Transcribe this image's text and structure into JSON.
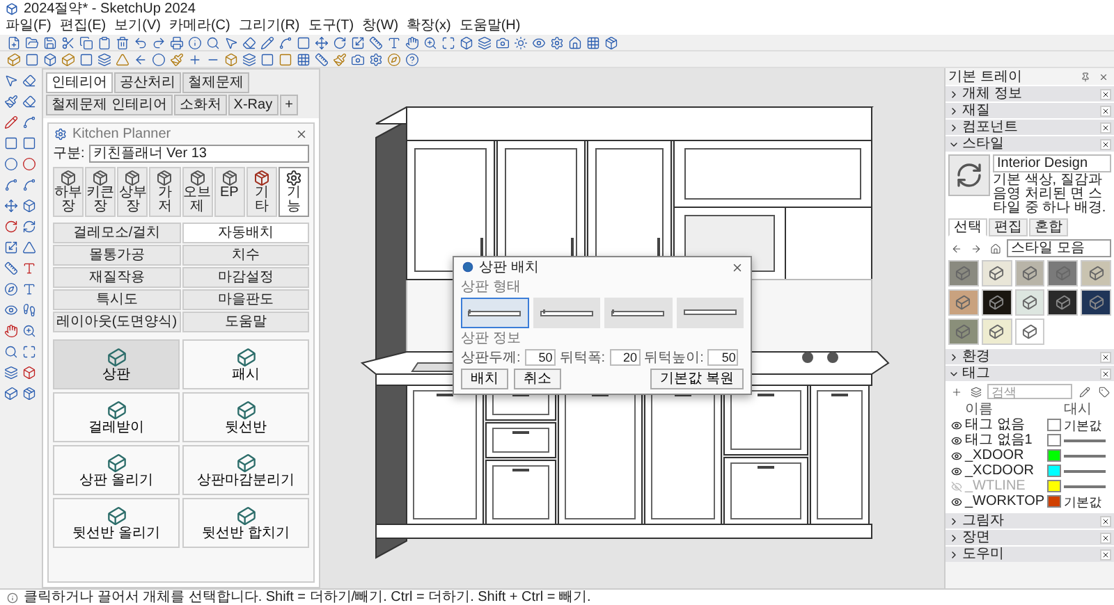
{
  "window": {
    "title": "2024절약* - SketchUp 2024"
  },
  "menu": [
    "파일(F)",
    "편집(E)",
    "보기(V)",
    "카메라(C)",
    "그리기(R)",
    "도구(T)",
    "창(W)",
    "확장(x)",
    "도움말(H)"
  ],
  "panel_tabs": [
    {
      "label": "인테리어",
      "selected": true
    },
    {
      "label": "공산처리",
      "selected": false
    },
    {
      "label": "철제문제",
      "selected": false
    },
    {
      "label": "철제문제 인테리어",
      "selected": false
    },
    {
      "label": "소화처",
      "selected": false
    },
    {
      "label": "X-Ray",
      "selected": false
    },
    {
      "label": "+",
      "selected": false
    }
  ],
  "kitchen_planner": {
    "title": "Kitchen Planner",
    "category_label": "구분:",
    "category_value": "키친플래너 Ver 13",
    "icon_tabs": [
      {
        "label": "하부장",
        "selected": false
      },
      {
        "label": "키큰장",
        "selected": false
      },
      {
        "label": "상부장",
        "selected": false
      },
      {
        "label": "가 저",
        "selected": false
      },
      {
        "label": "오브제",
        "selected": false
      },
      {
        "label": "EP",
        "selected": false
      },
      {
        "label": "기 타",
        "selected": false
      },
      {
        "label": "기 능",
        "selected": true
      }
    ],
    "functions": [
      {
        "label": "걸레모소/걸치",
        "selected": false
      },
      {
        "label": "자동배치",
        "selected": true
      },
      {
        "label": "몰통가공",
        "selected": false
      },
      {
        "label": "치수",
        "selected": false
      },
      {
        "label": "재질작용",
        "selected": false
      },
      {
        "label": "마감설정",
        "selected": false
      },
      {
        "label": "특시도",
        "selected": false
      },
      {
        "label": "마을판도",
        "selected": false
      },
      {
        "label": "레이아웃(도면양식)",
        "selected": false
      },
      {
        "label": "도움말",
        "selected": false
      }
    ],
    "buttons": [
      {
        "label": "상판",
        "selected": true
      },
      {
        "label": "패시",
        "selected": false
      },
      {
        "label": "걸레받이",
        "selected": false
      },
      {
        "label": "뒷선반",
        "selected": false
      },
      {
        "label": "상판 올리기",
        "selected": false
      },
      {
        "label": "상판마감분리기",
        "selected": false
      },
      {
        "label": "뒷선반 올리기",
        "selected": false
      },
      {
        "label": "뒷선반 합치기",
        "selected": false
      }
    ]
  },
  "dialog": {
    "title": "상판 배치",
    "shape_heading": "상판 형태",
    "shapes": [
      {
        "selected": true
      },
      {
        "selected": false
      },
      {
        "selected": false
      },
      {
        "selected": false
      }
    ],
    "info_heading": "상판 정보",
    "fields": [
      {
        "label": "상판두께:",
        "value": "50"
      },
      {
        "label": "뒤턱폭:",
        "value": "20"
      },
      {
        "label": "뒤턱높이:",
        "value": "50"
      }
    ],
    "buttons": [
      "배치",
      "취소",
      "기본값 복원"
    ]
  },
  "tray": {
    "title": "기본 트레이",
    "sections": [
      {
        "label": "개체 정보",
        "expanded": false
      },
      {
        "label": "재질",
        "expanded": false
      },
      {
        "label": "컴포넌트",
        "expanded": false
      },
      {
        "label": "스타일",
        "expanded": true,
        "kind": "style"
      },
      {
        "label": "환경",
        "expanded": false
      },
      {
        "label": "태그",
        "expanded": true,
        "kind": "tags"
      },
      {
        "label": "그림자",
        "expanded": false
      },
      {
        "label": "장면",
        "expanded": false
      },
      {
        "label": "도우미",
        "expanded": false
      }
    ]
  },
  "style": {
    "name": "Interior Design",
    "description": "기본 색상, 질감과 음영 처리된 면 스타일 중 하나 배경.",
    "tabs": [
      {
        "label": "선택",
        "selected": true
      },
      {
        "label": "편집",
        "selected": false
      },
      {
        "label": "혼합",
        "selected": false
      }
    ],
    "collection": "스타일 모음"
  },
  "tags": {
    "placeholder": "검색",
    "columns": [
      "이름",
      "대시"
    ],
    "rows": [
      {
        "name": "태그 없음",
        "color": "#ffffff",
        "visible": true,
        "dash": "기본값"
      },
      {
        "name": "태그 없음1",
        "color": "#ffffff",
        "visible": true
      },
      {
        "name": "_XDOOR",
        "color": "#00ff00",
        "visible": true
      },
      {
        "name": "_XCDOOR",
        "color": "#00ffff",
        "visible": true
      },
      {
        "name": "_WTLINE",
        "color": "#ffff00",
        "visible": false
      },
      {
        "name": "_WORKTOP",
        "color": "#d04000",
        "visible": true,
        "dash": "기본값"
      }
    ]
  },
  "status_bar": "클릭하거나 끌어서 개체를 선택합니다. Shift = 더하기/빼기. Ctrl = 더하기. Shift + Ctrl = 빼기."
}
